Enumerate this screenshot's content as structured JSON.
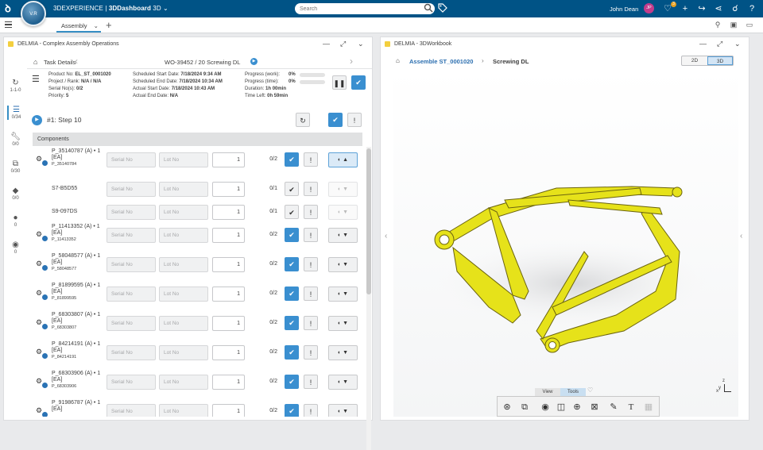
{
  "app": {
    "title_plain": "3DEXPERIENCE | ",
    "title_bold": "3DDashboard",
    "title_suffix": "3D",
    "logo_text": "V.R"
  },
  "search": {
    "placeholder": "Search"
  },
  "user": {
    "name": "John Dean",
    "initials": "JP",
    "notification_count": "3"
  },
  "dashboard_tab": {
    "label": "Assembly"
  },
  "left_panel": {
    "title": "DELMIA - Complex Assembly Operations",
    "nav": [
      {
        "icon": "refresh-icon",
        "label": "1-1-0"
      },
      {
        "icon": "list-icon",
        "label": "0/34"
      },
      {
        "icon": "wrench-icon",
        "label": "0/0"
      },
      {
        "icon": "puzzle-icon",
        "label": "0/30"
      },
      {
        "icon": "tag-icon",
        "label": "0/0"
      },
      {
        "icon": "alert-icon",
        "label": "0"
      },
      {
        "icon": "comment-icon",
        "label": "0"
      }
    ],
    "breadcrumb": "Task Details",
    "work_order": "WO-39452 / 20 Screwing DL",
    "info": {
      "product_no_label": "Product No:",
      "product_no": "EL_ST_0001020",
      "project_label": "Project / Rank:",
      "project": "N/A / N/A",
      "serial_label": "Serial No(s):",
      "serial": "0/2",
      "priority_label": "Priority:",
      "priority": "5",
      "sched_start_label": "Scheduled Start Date:",
      "sched_start": "7/18/2024 9:34 AM",
      "sched_end_label": "Scheduled End Date:",
      "sched_end": "7/18/2024 10:34 AM",
      "actual_start_label": "Actual Start Date:",
      "actual_start": "7/18/2024 10:43 AM",
      "actual_end_label": "Actual End Date:",
      "actual_end": "N/A",
      "prog_work_label": "Progress (work):",
      "prog_work": "0%",
      "prog_time_label": "Progress (time):",
      "prog_time": "0%",
      "duration_label": "Duration:",
      "duration": "1h 00min",
      "time_left_label": "Time Left:",
      "time_left": "0h 59min"
    },
    "step": "#1: Step 10",
    "components_header": "Components",
    "serial_placeholder": "Serial No",
    "lot_placeholder": "Lot No",
    "rows": [
      {
        "name": "P_35140787 (A) • 1 [EA]",
        "id": "P_35140784",
        "qty": "1",
        "count": "0/2",
        "kind": "part",
        "dd": "selected"
      },
      {
        "name": "S7-B5D55",
        "id": "",
        "qty": "1",
        "count": "0/1",
        "kind": "simple",
        "dd": "disabled"
      },
      {
        "name": "S9-097DS",
        "id": "",
        "qty": "1",
        "count": "0/1",
        "kind": "simple",
        "dd": "disabled"
      },
      {
        "name": "P_11413352 (A) • 1 [EA]",
        "id": "P_11413352",
        "qty": "1",
        "count": "0/2",
        "kind": "part",
        "dd": "normal"
      },
      {
        "name": "P_58048577 (A) • 1 [EA]",
        "id": "P_58048577",
        "qty": "1",
        "count": "0/2",
        "kind": "part",
        "dd": "normal"
      },
      {
        "name": "P_81899595 (A) • 1 [EA]",
        "id": "P_81899595",
        "qty": "1",
        "count": "0/2",
        "kind": "part",
        "dd": "normal"
      },
      {
        "name": "P_68303807 (A) • 1 [EA]",
        "id": "P_68303807",
        "qty": "1",
        "count": "0/2",
        "kind": "part",
        "dd": "normal"
      },
      {
        "name": "P_84214191 (A) • 1 [EA]",
        "id": "P_84214191",
        "qty": "1",
        "count": "0/2",
        "kind": "part",
        "dd": "normal"
      },
      {
        "name": "P_68303906 (A) • 1 [EA]",
        "id": "P_68303906",
        "qty": "1",
        "count": "0/2",
        "kind": "part",
        "dd": "normal"
      },
      {
        "name": "P_91986787 (A) • 1 [EA]",
        "id": "",
        "qty": "1",
        "count": "0/2",
        "kind": "part",
        "dd": "normal"
      }
    ]
  },
  "right_panel": {
    "title": "DELMIA - 3DWorkbook",
    "assembly_link": "Assemble ST_0001020",
    "operation": "Screwing DL",
    "mode_2d": "2D",
    "mode_3d": "3D",
    "tab_view": "View",
    "tab_tools": "Tools",
    "compass": {
      "z": "z",
      "y": "y",
      "x": "x"
    }
  },
  "colors": {
    "topbar": "#005386",
    "accent": "#3a8fd0",
    "model": "#e6e21a"
  }
}
